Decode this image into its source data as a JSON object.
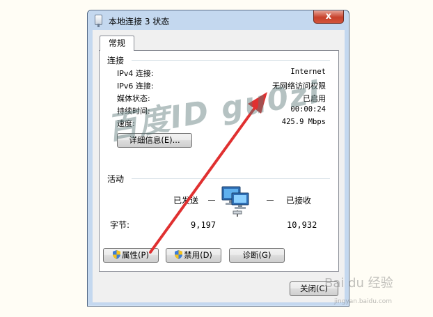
{
  "window": {
    "title": "本地连接 3 状态",
    "close_label": "x"
  },
  "tabs": [
    {
      "label": "常规"
    }
  ],
  "connection": {
    "group_label": "连接",
    "rows": [
      {
        "label": "IPv4 连接:",
        "value": "Internet"
      },
      {
        "label": "IPv6 连接:",
        "value": "无网络访问权限"
      },
      {
        "label": "媒体状态:",
        "value": "已启用"
      },
      {
        "label": "持续时间:",
        "value": "00:00:24"
      },
      {
        "label": "速度:",
        "value": "425.9 Mbps"
      }
    ],
    "details_button": "详细信息(E)..."
  },
  "activity": {
    "group_label": "活动",
    "sent_label": "已发送",
    "received_label": "已接收",
    "bytes_label": "字节:",
    "bytes_sent": "9,197",
    "bytes_received": "10,932"
  },
  "buttons": {
    "properties": "属性(P)",
    "disable": "禁用(D)",
    "diagnose": "诊断(G)",
    "close": "关闭(C)"
  },
  "overlay": {
    "watermark": "百度ID gu0zi",
    "logo": "Bai du 经验",
    "url": "jingyan.baidu.com"
  },
  "colors": {
    "arrow": "#e03030",
    "titlebar": "#c4d8ef",
    "close_button": "#c7412b"
  }
}
